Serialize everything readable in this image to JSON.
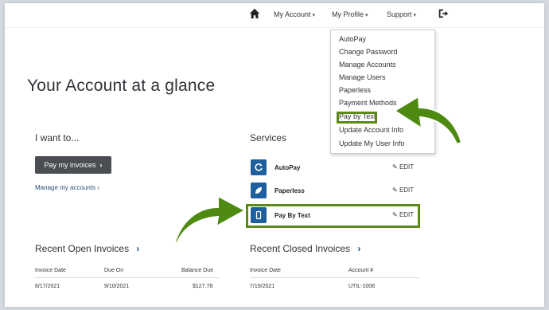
{
  "nav": {
    "my_account": "My Account",
    "my_profile": "My Profile",
    "support": "Support",
    "caret": "▾"
  },
  "profile_menu": {
    "items": [
      "AutoPay",
      "Change Password",
      "Manage Accounts",
      "Manage Users",
      "Paperless",
      "Payment Methods",
      "Pay by Text",
      "Update Account Info",
      "Update My User Info"
    ]
  },
  "page_title": "Your Account at a glance",
  "i_want_to": {
    "title": "I want to...",
    "pay_button": "Pay my invoices",
    "pay_button_chevron": "›",
    "manage_link": "Manage my accounts ›"
  },
  "services": {
    "title": "Services",
    "items": [
      {
        "label": "AutoPay",
        "edit": "EDIT",
        "icon": "refresh-icon"
      },
      {
        "label": "Paperless",
        "edit": "EDIT",
        "icon": "leaf-icon"
      },
      {
        "label": "Pay By Text",
        "edit": "EDIT",
        "icon": "phone-icon"
      }
    ]
  },
  "recent_open": {
    "title": "Recent Open Invoices",
    "chevron": "›",
    "columns": [
      "Invoice Date",
      "Due On",
      "Balance Due"
    ],
    "rows": [
      [
        "8/17/2021",
        "9/10/2021",
        "$127.78"
      ]
    ]
  },
  "recent_closed": {
    "title": "Recent Closed Invoices",
    "chevron": "›",
    "columns": [
      "Invoice Date",
      "Account #"
    ],
    "rows": [
      [
        "7/19/2021",
        "UTIL-1008"
      ]
    ]
  },
  "colors": {
    "highlight_green": "#5d8a17",
    "arrow_green": "#4e8a12",
    "service_blue": "#1e5f9e",
    "button_dark": "#4a4d52"
  }
}
